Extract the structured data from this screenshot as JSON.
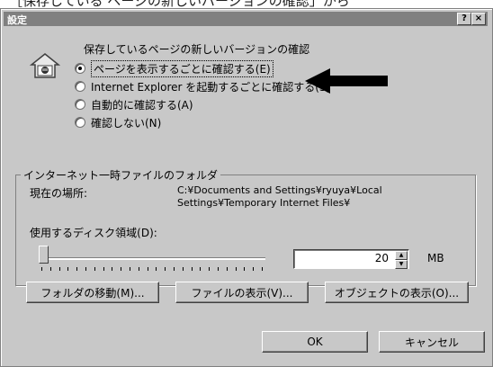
{
  "caption": "［保存している ページの新しいバージョンの確認」から",
  "window": {
    "title": "設定",
    "help_glyph": "?",
    "close_glyph": "×"
  },
  "check_section": {
    "heading": "保存しているページの新しいバージョンの確認",
    "options": [
      {
        "label": "ページを表示するごとに確認する(E)",
        "selected": true
      },
      {
        "label": "Internet Explorer を起動するごとに確認する(S)",
        "selected": false
      },
      {
        "label": "自動的に確認する(A)",
        "selected": false
      },
      {
        "label": "確認しない(N)",
        "selected": false
      }
    ]
  },
  "temp_folder": {
    "group_title": "インターネット一時ファイルのフォルダ",
    "location_label": "現在の場所:",
    "location_path": "C:¥Documents and Settings¥ryuya¥Local Settings¥Temporary Internet Files¥",
    "disk_label": "使用するディスク領域(D):",
    "disk_value": "20",
    "unit": "MB",
    "slider_level": 0
  },
  "folder_buttons": {
    "move": "フォルダの移動(M)...",
    "view_files": "ファイルの表示(V)...",
    "view_objects": "オブジェクトの表示(O)..."
  },
  "footer": {
    "ok": "OK",
    "cancel": "キャンセル"
  },
  "colors": {
    "dialog_bg": "#c8c8c8",
    "titlebar": "#808080",
    "arrow": "#000000"
  }
}
